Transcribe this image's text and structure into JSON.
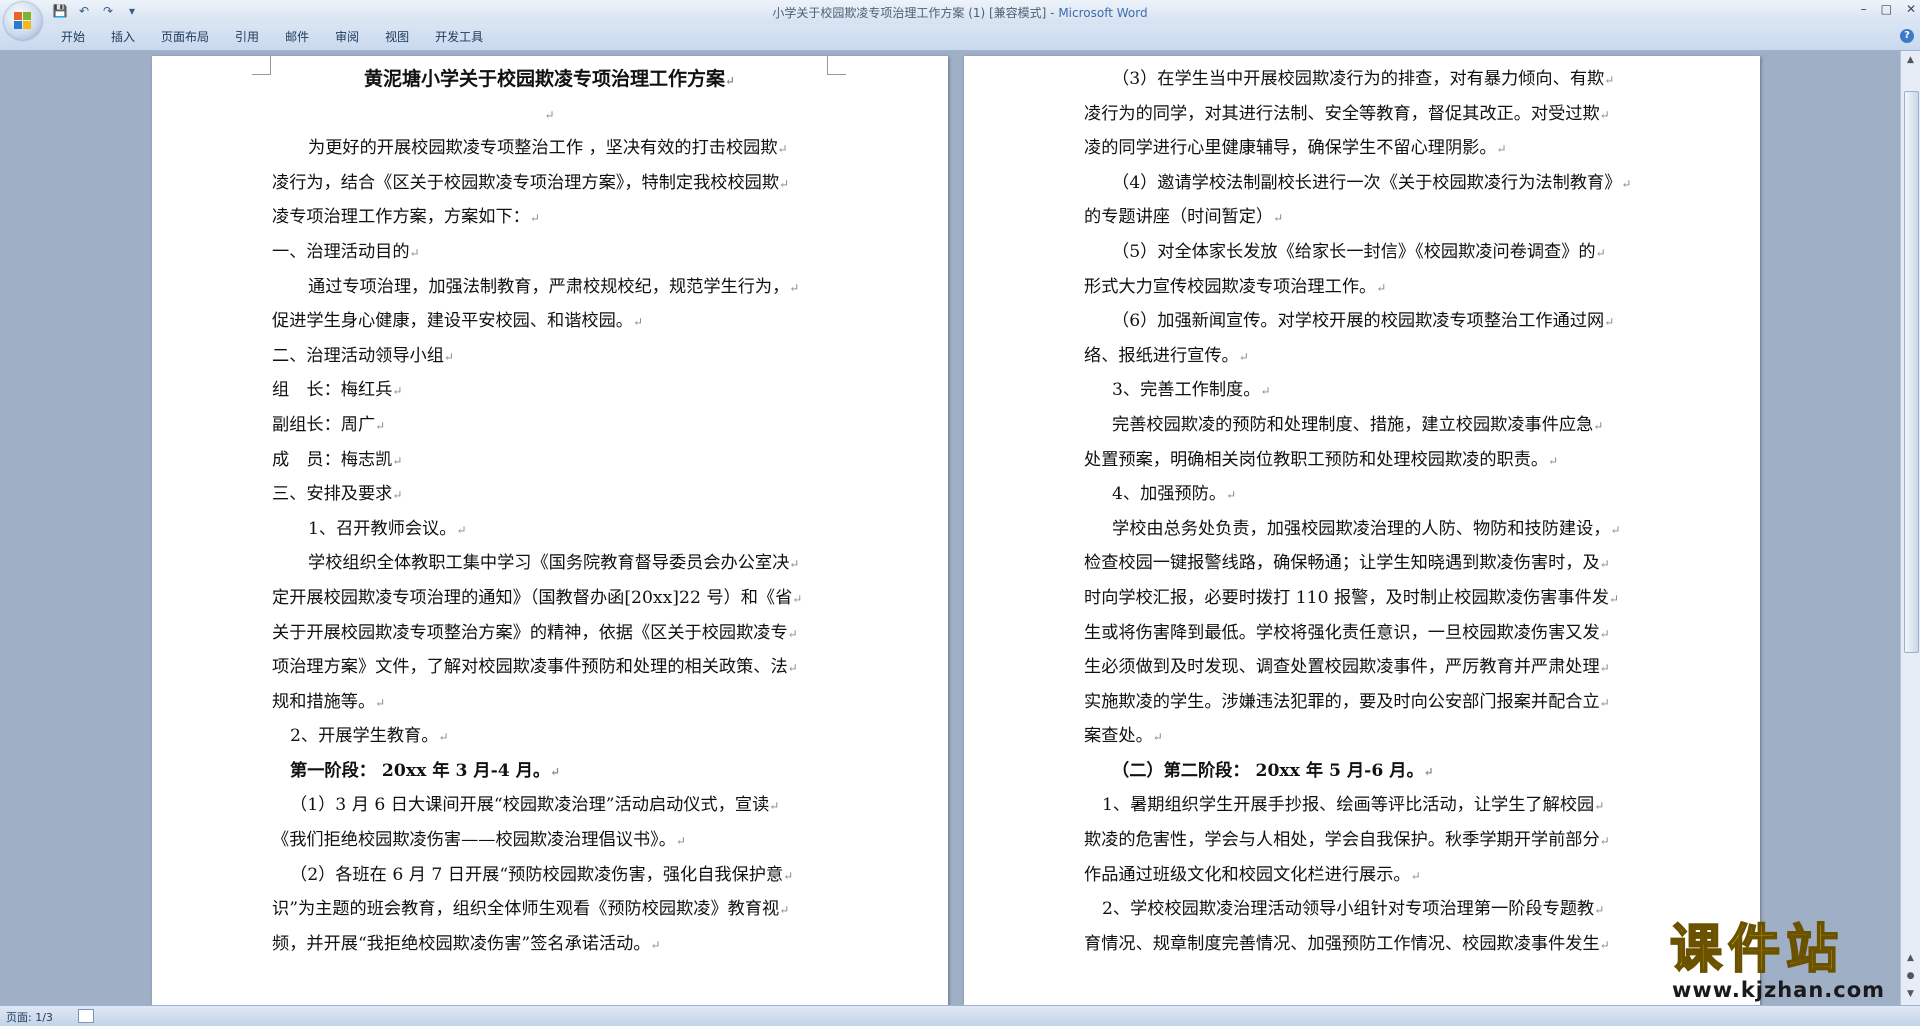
{
  "window": {
    "title": "小学关于校园欺凌专项治理工作方案 (1) [兼容模式] - ",
    "app_name": "Microsoft Word",
    "controls": [
      "–",
      "□",
      "✕"
    ]
  },
  "quick_access": {
    "icons": [
      "save-icon",
      "undo-icon",
      "redo-icon",
      "customize-icon"
    ]
  },
  "ribbon": {
    "tabs": [
      "开始",
      "插入",
      "页面布局",
      "引用",
      "邮件",
      "审阅",
      "视图",
      "开发工具"
    ],
    "help": "?"
  },
  "document": {
    "left_page": [
      {
        "text": "黄泥塘小学关于校园欺凌专项治理工作方案",
        "style": "title"
      },
      {
        "text": "",
        "style": "center"
      },
      {
        "text": "为更好的开展校园欺凌专项整治工作 ，坚决有效的打击校园欺",
        "style": "ind"
      },
      {
        "text": "凌行为，结合《区关于校园欺凌专项治理方案》，特制定我校校园欺",
        "style": ""
      },
      {
        "text": "凌专项治理工作方案，方案如下：",
        "style": ""
      },
      {
        "text": "一、治理活动目的",
        "style": ""
      },
      {
        "text": "通过专项治理，加强法制教育，严肃校规校纪，规范学生行为，",
        "style": "ind"
      },
      {
        "text": "促进学生身心健康，建设平安校园、和谐校园。",
        "style": ""
      },
      {
        "text": "二、治理活动领导小组",
        "style": ""
      },
      {
        "text": "组　长：梅红兵",
        "style": ""
      },
      {
        "text": "副组长：周广",
        "style": ""
      },
      {
        "text": "成　员：梅志凯",
        "style": ""
      },
      {
        "text": "三、安排及要求",
        "style": ""
      },
      {
        "text": "1、召开教师会议。",
        "style": "ind"
      },
      {
        "text": "学校组织全体教职工集中学习《国务院教育督导委员会办公室决",
        "style": "ind"
      },
      {
        "text": "定开展校园欺凌专项治理的通知》（国教督办函[20xx]22 号）和《省",
        "style": ""
      },
      {
        "text": "关于开展校园欺凌专项整治方案》的精神，依据《区关于校园欺凌专",
        "style": ""
      },
      {
        "text": "项治理方案》文件，了解对校园欺凌事件预防和处理的相关政策、法",
        "style": ""
      },
      {
        "text": "规和措施等。",
        "style": ""
      },
      {
        "text": "2、开展学生教育。",
        "style": "ind2"
      },
      {
        "text": "第一阶段：  20xx 年 3 月-4 月。",
        "style": "ind2 b"
      },
      {
        "text": "（1）3 月 6 日大课间开展“校园欺凌治理”活动启动仪式，宣读",
        "style": "ind2"
      },
      {
        "text": "《我们拒绝校园欺凌伤害——校园欺凌治理倡议书》。",
        "style": ""
      },
      {
        "text": "（2）各班在 6 月 7 日开展“预防校园欺凌伤害，强化自我保护意",
        "style": "ind2"
      },
      {
        "text": "识”为主题的班会教育，组织全体师生观看《预防校园欺凌》教育视",
        "style": ""
      },
      {
        "text": "频，并开展“我拒绝校园欺凌伤害”签名承诺活动。",
        "style": ""
      }
    ],
    "right_page": [
      {
        "text": "（3）在学生当中开展校园欺凌行为的排查，对有暴力倾向、有欺",
        "style": "ind1"
      },
      {
        "text": "凌行为的同学，对其进行法制、安全等教育，督促其改正。对受过欺",
        "style": ""
      },
      {
        "text": "凌的同学进行心里健康辅导，确保学生不留心理阴影。",
        "style": ""
      },
      {
        "text": "（4）邀请学校法制副校长进行一次《关于校园欺凌行为法制教育》",
        "style": "ind1"
      },
      {
        "text": "的专题讲座（时间暂定）",
        "style": ""
      },
      {
        "text": "（5）对全体家长发放《给家长一封信》《校园欺凌问卷调查》的",
        "style": "ind1"
      },
      {
        "text": "形式大力宣传校园欺凌专项治理工作。",
        "style": ""
      },
      {
        "text": "（6）加强新闻宣传。对学校开展的校园欺凌专项整治工作通过网",
        "style": "ind1"
      },
      {
        "text": "络、报纸进行宣传。",
        "style": ""
      },
      {
        "text": "3、完善工作制度。",
        "style": "ind1"
      },
      {
        "text": "完善校园欺凌的预防和处理制度、措施，建立校园欺凌事件应急",
        "style": "ind1"
      },
      {
        "text": "处置预案，明确相关岗位教职工预防和处理校园欺凌的职责。",
        "style": ""
      },
      {
        "text": "4、加强预防。",
        "style": "ind1"
      },
      {
        "text": "学校由总务处负责，加强校园欺凌治理的人防、物防和技防建设，",
        "style": "ind1"
      },
      {
        "text": "检查校园一键报警线路，确保畅通；让学生知晓遇到欺凌伤害时，及",
        "style": ""
      },
      {
        "text": "时向学校汇报，必要时拨打 110 报警，及时制止校园欺凌伤害事件发",
        "style": ""
      },
      {
        "text": "生或将伤害降到最低。学校将强化责任意识，一旦校园欺凌伤害又发",
        "style": ""
      },
      {
        "text": "生必须做到及时发现、调查处置校园欺凌事件，严厉教育并严肃处理",
        "style": ""
      },
      {
        "text": "实施欺凌的学生。涉嫌违法犯罪的，要及时向公安部门报案并配合立",
        "style": ""
      },
      {
        "text": "案查处。",
        "style": ""
      },
      {
        "text": "（二）第二阶段：  20xx 年 5 月-6 月。",
        "style": "ind1 b"
      },
      {
        "text": "1、暑期组织学生开展手抄报、绘画等评比活动，让学生了解校园",
        "style": "ind2"
      },
      {
        "text": "欺凌的危害性，学会与人相处，学会自我保护。秋季学期开学前部分",
        "style": ""
      },
      {
        "text": "作品通过班级文化和校园文化栏进行展示。",
        "style": ""
      },
      {
        "text": "2、学校校园欺凌治理活动领导小组针对专项治理第一阶段专题教",
        "style": "ind2"
      },
      {
        "text": "育情况、规章制度完善情况、加强预防工作情况、校园欺凌事件发生",
        "style": ""
      }
    ],
    "paragraph_mark": "↵"
  },
  "status": {
    "page": "页面: 1/3"
  },
  "watermark": {
    "main": "课件站",
    "url": "www.kjzhan.com"
  },
  "colors": {
    "accent": "#3b6bb0",
    "workspace": "#9fafc6",
    "watermark_fill": "#f0d000"
  }
}
